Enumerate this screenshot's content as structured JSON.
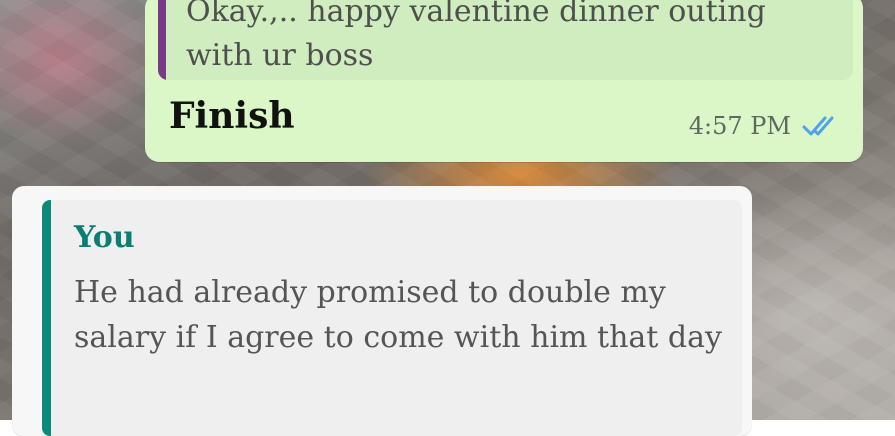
{
  "conversation": {
    "sent_message": {
      "quoted_text": "Okay.,.. happy valentine dinner outing\nwith ur boss",
      "text": "Finish",
      "time": "4:57 PM",
      "status_icon": "double-check-icon",
      "status_color": "#4fa3e8"
    },
    "received_message": {
      "quoted_author": "You",
      "quoted_text": "He had already promised to double my salary if I agree to come with him that day"
    }
  },
  "colors": {
    "sent_bubble": "#dbf7c8",
    "received_bubble": "#f7f7f7",
    "quote_bar_sent": "#7a3b86",
    "quote_bar_received": "#0b8a7c"
  }
}
